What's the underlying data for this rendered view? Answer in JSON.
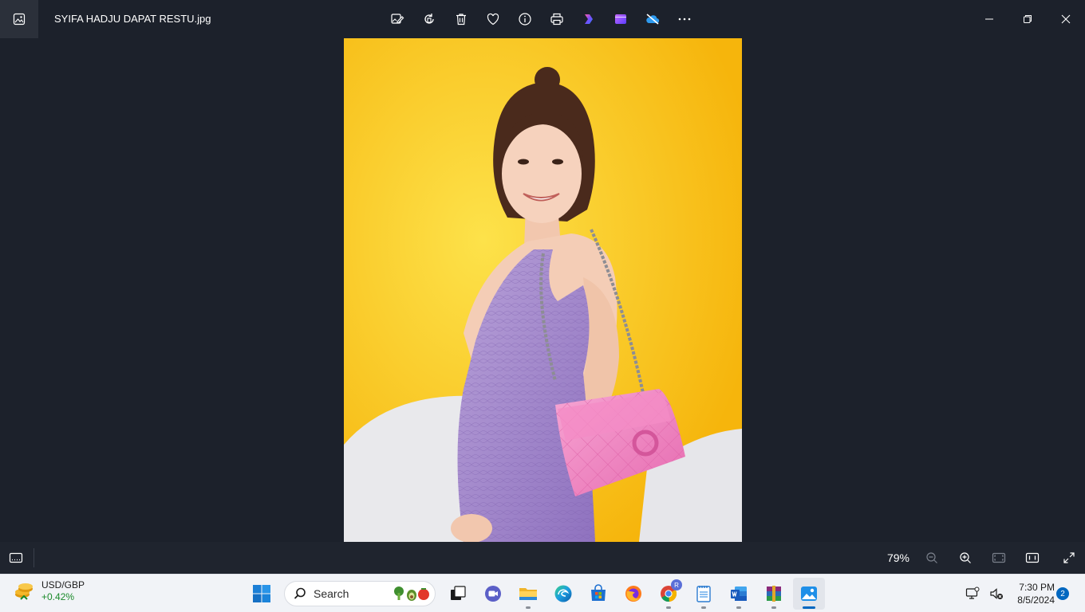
{
  "window": {
    "file_title": "SYIFA HADJU DAPAT RESTU.jpg",
    "toolbar": [
      "edit-image-icon",
      "rotate-icon",
      "delete-icon",
      "favorite-icon",
      "info-icon",
      "print-icon",
      "clipchamp-icon",
      "video-editor-icon",
      "onedrive-off-icon",
      "more-icon"
    ]
  },
  "viewer": {
    "zoom_level": "79%"
  },
  "taskbar": {
    "widget": {
      "pair": "USD/GBP",
      "change": "+0.42%"
    },
    "search_label": "Search",
    "clock": {
      "time": "7:30 PM",
      "date": "8/5/2024"
    },
    "notification_count": "2",
    "chrome_badge": "R"
  },
  "colors": {
    "window_bg": "#1c212b",
    "taskbar_bg": "#f1f3f7",
    "accent": "#0067c0",
    "photo_bg": "#f8c61d"
  }
}
